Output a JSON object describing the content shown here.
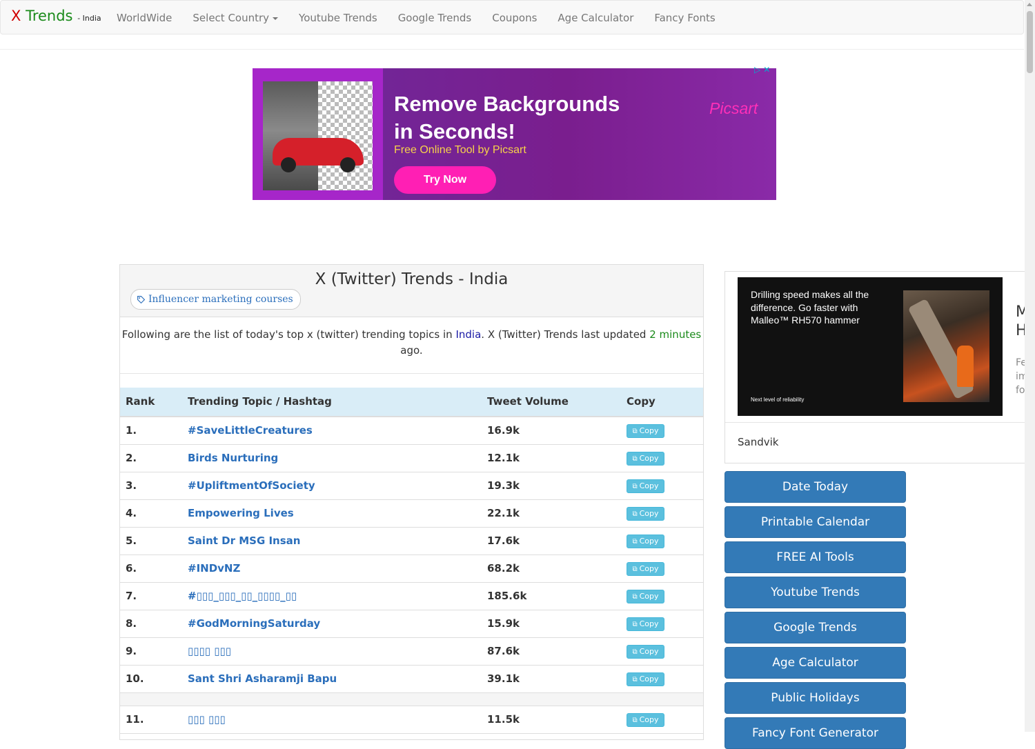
{
  "navbar": {
    "brand_x": "X",
    "brand_trends": "Trends",
    "brand_country": "- India",
    "links": [
      "WorldWide",
      "Select Country",
      "Youtube Trends",
      "Google Trends",
      "Coupons",
      "Age Calculator",
      "Fancy Fonts"
    ]
  },
  "ad_banner": {
    "title": "Remove Backgrounds in Seconds!",
    "subtitle": "Free Online Tool by Picsart",
    "button": "Try Now",
    "logo": "Picsart",
    "choices_icons": [
      "adchoices-icon",
      "close-icon"
    ]
  },
  "panel": {
    "title": "X (Twitter) Trends - India",
    "tag_chip": "Influencer marketing courses",
    "intro_prefix": "Following are the list of today's top x (twitter) trending topics in ",
    "intro_country": "India",
    "intro_middle": ". X (Twitter) Trends last updated ",
    "intro_minutes": "2 minutes",
    "intro_suffix": " ago."
  },
  "table": {
    "headers": [
      "Rank",
      "Trending Topic / Hashtag",
      "Tweet Volume",
      "Copy"
    ],
    "copy_label": "Copy",
    "rows": [
      {
        "rank": "1.",
        "topic": "#SaveLittleCreatures",
        "volume": "16.9k"
      },
      {
        "rank": "2.",
        "topic": "Birds Nurturing",
        "volume": "12.1k"
      },
      {
        "rank": "3.",
        "topic": "#UpliftmentOfSociety",
        "volume": "19.3k"
      },
      {
        "rank": "4.",
        "topic": "Empowering Lives",
        "volume": "22.1k"
      },
      {
        "rank": "5.",
        "topic": "Saint Dr MSG Insan",
        "volume": "17.6k"
      },
      {
        "rank": "6.",
        "topic": "#INDvNZ",
        "volume": "68.2k"
      },
      {
        "rank": "7.",
        "topic": "#▯▯▯_▯▯▯_▯▯_▯▯▯▯_▯▯",
        "volume": "185.6k"
      },
      {
        "rank": "8.",
        "topic": "#GodMorningSaturday",
        "volume": "15.9k"
      },
      {
        "rank": "9.",
        "topic": "▯▯▯▯ ▯▯▯",
        "volume": "87.6k"
      },
      {
        "rank": "10.",
        "topic": "Sant Shri Asharamji Bapu",
        "volume": "39.1k"
      },
      {
        "rank": "11.",
        "topic": "▯▯▯ ▯▯▯",
        "volume": "11.5k"
      }
    ]
  },
  "side_ad": {
    "text": "Drilling speed makes all the difference. Go faster with Malleo™ RH570 hammer",
    "foot": "Next level of reliability",
    "brand": "Sandvik",
    "cut_heading": "M H",
    "cut_body": "Fe im fo"
  },
  "side_buttons": [
    "Date Today",
    "Printable Calendar",
    "FREE AI Tools",
    "Youtube Trends",
    "Google Trends",
    "Age Calculator",
    "Public Holidays",
    "Fancy Font Generator"
  ]
}
